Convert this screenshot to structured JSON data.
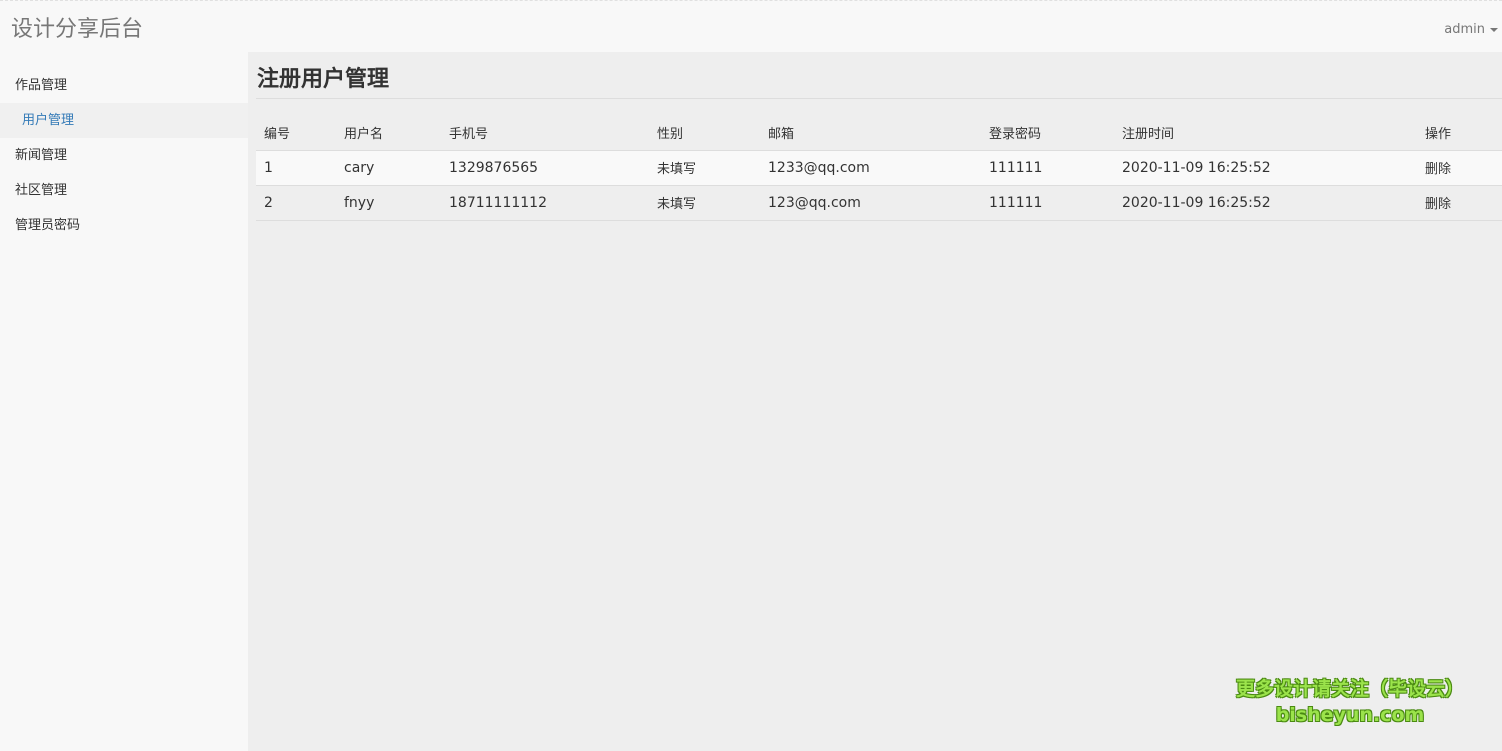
{
  "header": {
    "brand": "设计分享后台",
    "user_label": "admin"
  },
  "sidebar": {
    "items": [
      {
        "label": "作品管理"
      },
      {
        "label": "用户管理"
      },
      {
        "label": "新闻管理"
      },
      {
        "label": "社区管理"
      },
      {
        "label": "管理员密码"
      }
    ],
    "active_index": 1
  },
  "main": {
    "title": "注册用户管理",
    "table": {
      "columns": [
        "编号",
        "用户名",
        "手机号",
        "性别",
        "邮箱",
        "登录密码",
        "注册时间",
        "操作"
      ],
      "rows": [
        {
          "id": "1",
          "username": "cary",
          "phone": "1329876565",
          "gender": "未填写",
          "email": "1233@qq.com",
          "password": "111111",
          "registered": "2020-11-09 16:25:52",
          "action": "删除"
        },
        {
          "id": "2",
          "username": "fnyy",
          "phone": "18711111112",
          "gender": "未填写",
          "email": "123@qq.com",
          "password": "111111",
          "registered": "2020-11-09 16:25:52",
          "action": "删除"
        }
      ]
    }
  },
  "watermark": {
    "line1": "更多设计请关注（毕设云）",
    "line2": "bisheyun.com"
  },
  "colors": {
    "accent": "#337ab7",
    "watermark": "#9be34b"
  }
}
